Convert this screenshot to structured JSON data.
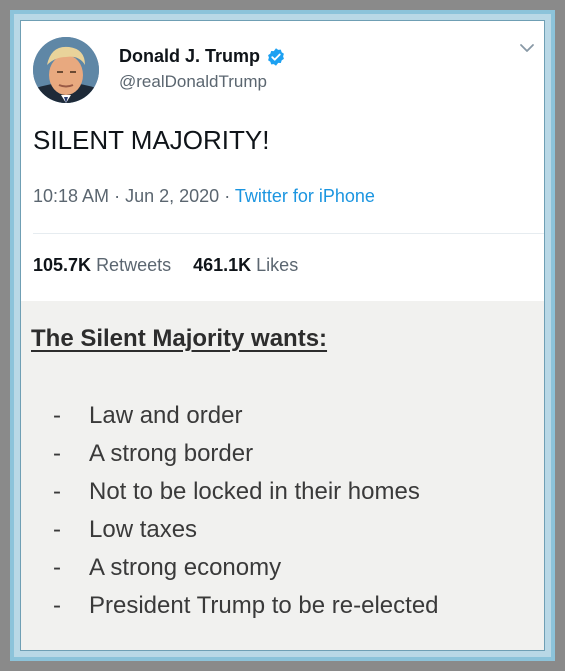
{
  "tweet": {
    "display_name": "Donald J. Trump",
    "handle": "@realDonaldTrump",
    "text": "SILENT MAJORITY!",
    "time": "10:18 AM",
    "date": "Jun 2, 2020",
    "source": "Twitter for iPhone",
    "separator": "·",
    "retweets_count": "105.7K",
    "retweets_label": "Retweets",
    "likes_count": "461.1K",
    "likes_label": "Likes"
  },
  "icons": {
    "avatar": "profile-photo",
    "verified": "verified-badge-icon",
    "menu": "chevron-down-icon"
  },
  "colors": {
    "verified": "#1da1f2",
    "source_link": "#1b95e0",
    "frame": "#8cc3da"
  },
  "note": {
    "title": "The Silent Majority wants:",
    "dash": "-",
    "items": [
      "Law and order",
      "A strong border",
      "Not to be locked in their homes",
      "Low taxes",
      "A strong economy",
      "President Trump to be re-elected"
    ]
  }
}
